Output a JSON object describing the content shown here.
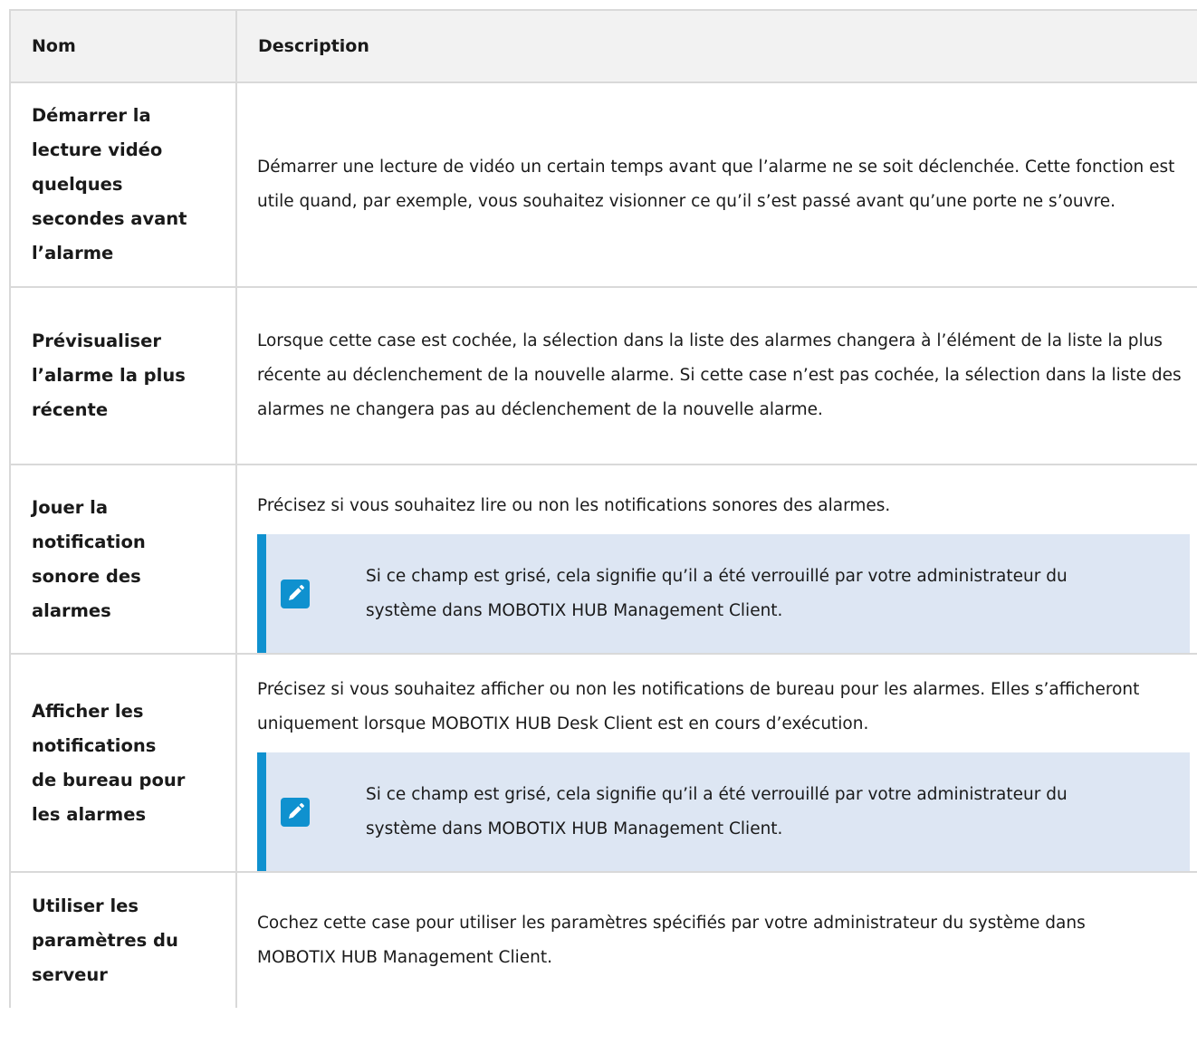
{
  "table": {
    "headers": {
      "name": "Nom",
      "description": "Description"
    },
    "rows": [
      {
        "name": "Démarrer la lecture vidéo quelques secondes avant l’alarme",
        "description": "Démarrer une lecture de vidéo un certain temps avant que l’alarme ne se soit déclenchée. Cette fonction est utile quand, par exemple, vous souhaitez visionner ce qu’il s’est passé avant qu’une porte ne s’ouvre."
      },
      {
        "name": "Prévisualiser l’alarme la plus récente",
        "description": "Lorsque cette case est cochée, la sélection dans la liste des alarmes changera à l’élément de la liste la plus récente au déclenchement de la nouvelle alarme. Si cette case n’est pas cochée, la sélection dans la liste des alarmes ne changera pas au déclenchement de la nouvelle alarme."
      },
      {
        "name": "Jouer la notification sonore des alarmes",
        "description": "Précisez si vous souhaitez lire ou non les notifications sonores des alarmes.",
        "note": "Si ce champ est grisé, cela signifie qu’il a été verrouillé par votre administrateur du système dans MOBOTIX HUB Management Client."
      },
      {
        "name": "Afficher les notifications de bureau pour les alarmes",
        "description": "Précisez si vous souhaitez afficher ou non les notifications de bureau pour les alarmes. Elles s’afficheront uniquement lorsque MOBOTIX HUB Desk Client est en cours d’exécution.",
        "note": "Si ce champ est grisé, cela signifie qu’il a été verrouillé par votre administrateur du système dans MOBOTIX HUB Management Client."
      },
      {
        "name": "Utiliser les paramètres du serveur",
        "description": "Cochez cette case pour utiliser les paramètres spécifiés par votre administrateur du système dans MOBOTIX HUB Management Client."
      }
    ]
  },
  "icons": {
    "note": "pencil-edit-icon",
    "note_icon_bg": "#0f91cf",
    "note_bg": "#dde6f3"
  }
}
